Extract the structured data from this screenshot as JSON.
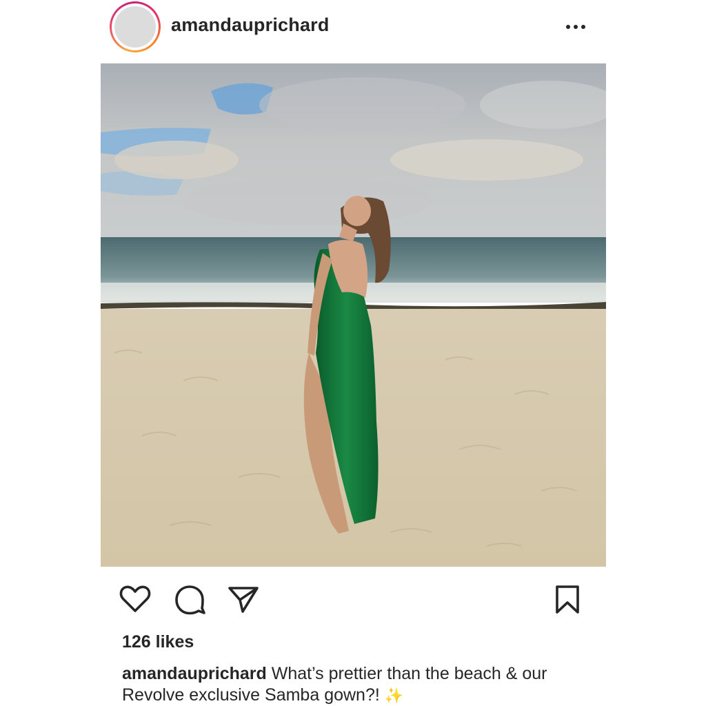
{
  "post": {
    "username": "amandauprichard",
    "likes_text": "126 likes",
    "caption_user": "amandauprichard",
    "caption_text": "What’s prettier than the beach & our Revolve exclusive Samba gown?!",
    "caption_emoji": "✨"
  },
  "icons": {
    "more": "more-options-icon",
    "like": "heart-icon",
    "comment": "comment-icon",
    "share": "paper-plane-icon",
    "save": "bookmark-icon"
  },
  "colors": {
    "text": "#262626",
    "ring_start": "#f9a640",
    "ring_end": "#c2217f",
    "dress": "#0f7a3a"
  }
}
